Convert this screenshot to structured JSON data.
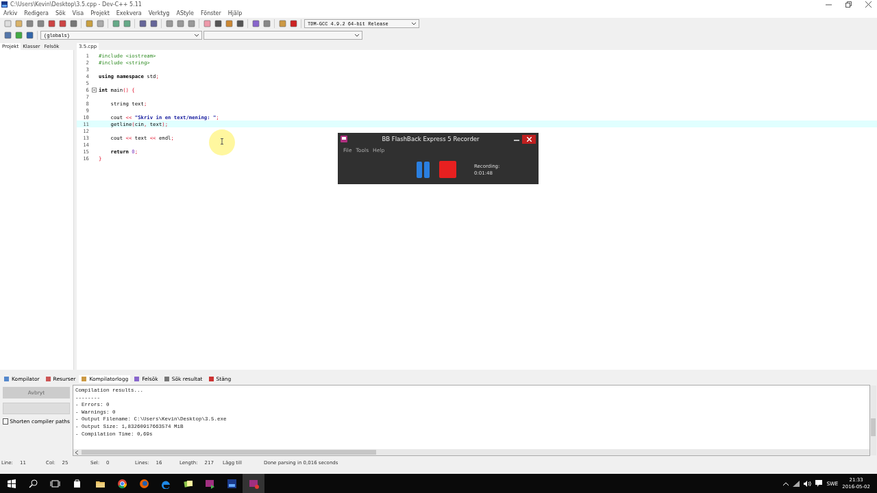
{
  "window": {
    "title": "C:\\Users\\Kevin\\Desktop\\3.5.cpp - Dev-C++ 5.11"
  },
  "menu": [
    "Arkiv",
    "Redigera",
    "Sök",
    "Visa",
    "Projekt",
    "Exekvera",
    "Verktyg",
    "AStyle",
    "Fönster",
    "Hjälp"
  ],
  "compiler_select": {
    "value": "TDM-GCC 4.9.2 64-bit Release"
  },
  "scope_select": {
    "value": "(globals)"
  },
  "side_tabs": [
    {
      "label": "Projekt",
      "selected": true
    },
    {
      "label": "Klasser",
      "selected": false
    },
    {
      "label": "Felsök",
      "selected": false
    }
  ],
  "editor_tabs": [
    {
      "label": "3.5.cpp",
      "selected": true
    }
  ],
  "code": [
    {
      "number": "1",
      "current": false,
      "tokens": [
        {
          "kind": "pre",
          "text": "#include <iostream>"
        }
      ]
    },
    {
      "number": "2",
      "current": false,
      "tokens": [
        {
          "kind": "pre",
          "text": "#include <string>"
        }
      ]
    },
    {
      "number": "3",
      "current": false
    },
    {
      "number": "4",
      "current": false,
      "tokens": [
        {
          "kind": "kw",
          "text": "using namespace"
        },
        {
          "kind": "plain",
          "text": " std"
        },
        {
          "kind": "sym",
          "text": ";"
        }
      ]
    },
    {
      "number": "5",
      "current": false
    },
    {
      "number": "6",
      "current": false,
      "fold": true,
      "tokens": [
        {
          "kind": "kw",
          "text": "int"
        },
        {
          "kind": "plain",
          "text": " main"
        },
        {
          "kind": "sym",
          "text": "() {"
        }
      ]
    },
    {
      "number": "7",
      "current": false
    },
    {
      "number": "8",
      "current": false,
      "tokens": [
        {
          "kind": "plain",
          "text": "    string text"
        },
        {
          "kind": "sym",
          "text": ";"
        }
      ]
    },
    {
      "number": "9",
      "current": false
    },
    {
      "number": "10",
      "current": false,
      "tokens": [
        {
          "kind": "plain",
          "text": "    cout "
        },
        {
          "kind": "sym",
          "text": "<<"
        },
        {
          "kind": "str",
          "text": " \"Skriv in en text/mening: \""
        },
        {
          "kind": "sym",
          "text": ";"
        }
      ]
    },
    {
      "number": "11",
      "current": true,
      "tokens": [
        {
          "kind": "plain",
          "text": "    getline"
        },
        {
          "kind": "sym",
          "text": "("
        },
        {
          "kind": "plain",
          "text": "cin"
        },
        {
          "kind": "sym",
          "text": ","
        },
        {
          "kind": "plain",
          "text": " text"
        },
        {
          "kind": "sym",
          "text": ");"
        }
      ]
    },
    {
      "number": "12",
      "current": false
    },
    {
      "number": "13",
      "current": false,
      "tokens": [
        {
          "kind": "plain",
          "text": "    cout "
        },
        {
          "kind": "sym",
          "text": "<<"
        },
        {
          "kind": "plain",
          "text": " text "
        },
        {
          "kind": "sym",
          "text": "<<"
        },
        {
          "kind": "plain",
          "text": " endl"
        },
        {
          "kind": "sym",
          "text": ";"
        }
      ]
    },
    {
      "number": "14",
      "current": false
    },
    {
      "number": "15",
      "current": false,
      "tokens": [
        {
          "kind": "kw",
          "text": "    return"
        },
        {
          "kind": "num",
          "text": " 0"
        },
        {
          "kind": "sym",
          "text": ";"
        }
      ]
    },
    {
      "number": "16",
      "current": false,
      "tokens": [
        {
          "kind": "sym",
          "text": "}"
        }
      ]
    }
  ],
  "recorder": {
    "title": "BB FlashBack Express 5 Recorder",
    "menu": [
      "File",
      "Tools",
      "Help"
    ],
    "status": "Recording:",
    "time": "0:01:48"
  },
  "bottom_tabs": [
    {
      "label": "Kompilator",
      "selected": false
    },
    {
      "label": "Resurser",
      "selected": false
    },
    {
      "label": "Kompilatorlogg",
      "selected": true
    },
    {
      "label": "Felsök",
      "selected": false
    },
    {
      "label": "Sök resultat",
      "selected": false
    },
    {
      "label": "Stäng",
      "selected": false
    }
  ],
  "abort_button": {
    "label": "Avbryt",
    "disabled": true
  },
  "shorten_paths": {
    "label": "Shorten compiler paths",
    "checked": false
  },
  "log": [
    "Compilation results...",
    "--------",
    "- Errors: 0",
    "- Warnings: 0",
    "- Output Filename: C:\\Users\\Kevin\\Desktop\\3.5.exe",
    "- Output Size: 1,83260917663574 MiB",
    "- Compilation Time: 0,69s"
  ],
  "status_bar": [
    {
      "label": "Line:",
      "value": "11"
    },
    {
      "label": "Col:",
      "value": "25"
    },
    {
      "label": "Sel:",
      "value": "0"
    },
    {
      "label": "Lines:",
      "value": "16"
    },
    {
      "label": "Length:",
      "value": "217"
    }
  ],
  "status_mode": "Lägg till",
  "status_message": "Done parsing in 0,016 seconds",
  "taskbar": {
    "language": "SWE",
    "time": "21:33",
    "date": "2016-05-02"
  }
}
